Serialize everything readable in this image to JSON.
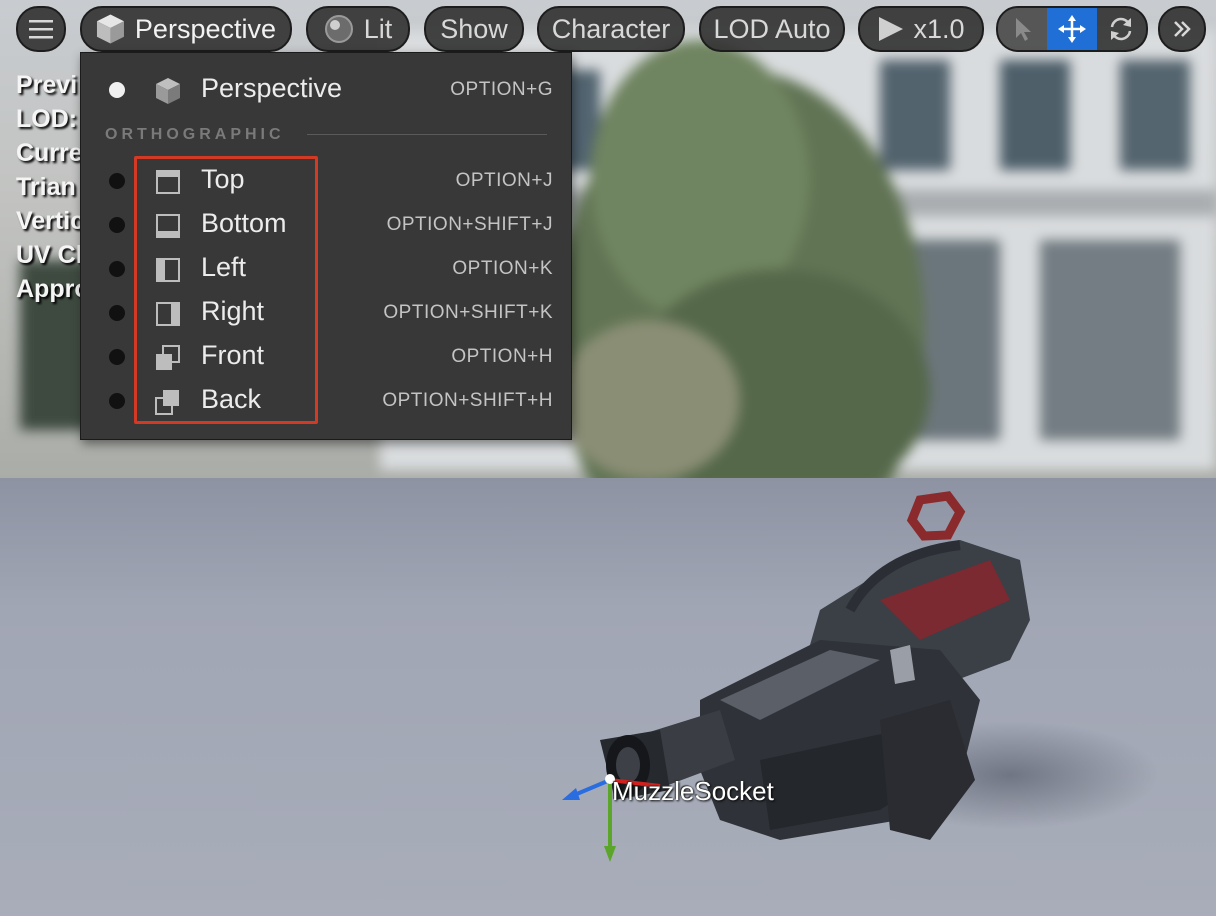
{
  "toolbar": {
    "view_mode_label": "Perspective",
    "lighting_label": "Lit",
    "show_label": "Show",
    "character_label": "Character",
    "lod_label": "LOD Auto",
    "play_speed_label": "x1.0",
    "icons": [
      "hamburger-menu-icon",
      "cube-icon",
      "lit-sphere-icon",
      "play-icon",
      "select-arrow-icon",
      "translate-icon",
      "rotate-icon",
      "double-chevron-icon"
    ],
    "active_tool": "translate",
    "accent_color": "#1f6fd6"
  },
  "stats_overlay": {
    "lines": [
      "Previ",
      "LOD:",
      "Curre",
      "Trian",
      "Vertic",
      "UV Ch",
      "Appro"
    ]
  },
  "view_menu": {
    "perspective": {
      "label": "Perspective",
      "shortcut": "OPTION+G",
      "icon": "cube-icon",
      "selected": true
    },
    "section_title": "ORTHOGRAPHIC",
    "items": [
      {
        "label": "Top",
        "shortcut": "OPTION+J",
        "icon": "view-top-icon"
      },
      {
        "label": "Bottom",
        "shortcut": "OPTION+SHIFT+J",
        "icon": "view-bottom-icon"
      },
      {
        "label": "Left",
        "shortcut": "OPTION+K",
        "icon": "view-left-icon"
      },
      {
        "label": "Right",
        "shortcut": "OPTION+SHIFT+K",
        "icon": "view-right-icon"
      },
      {
        "label": "Front",
        "shortcut": "OPTION+H",
        "icon": "view-front-icon"
      },
      {
        "label": "Back",
        "shortcut": "OPTION+SHIFT+H",
        "icon": "view-back-icon"
      }
    ],
    "highlight_color": "#d33a25"
  },
  "viewport": {
    "socket_label": "MuzzleSocket"
  }
}
